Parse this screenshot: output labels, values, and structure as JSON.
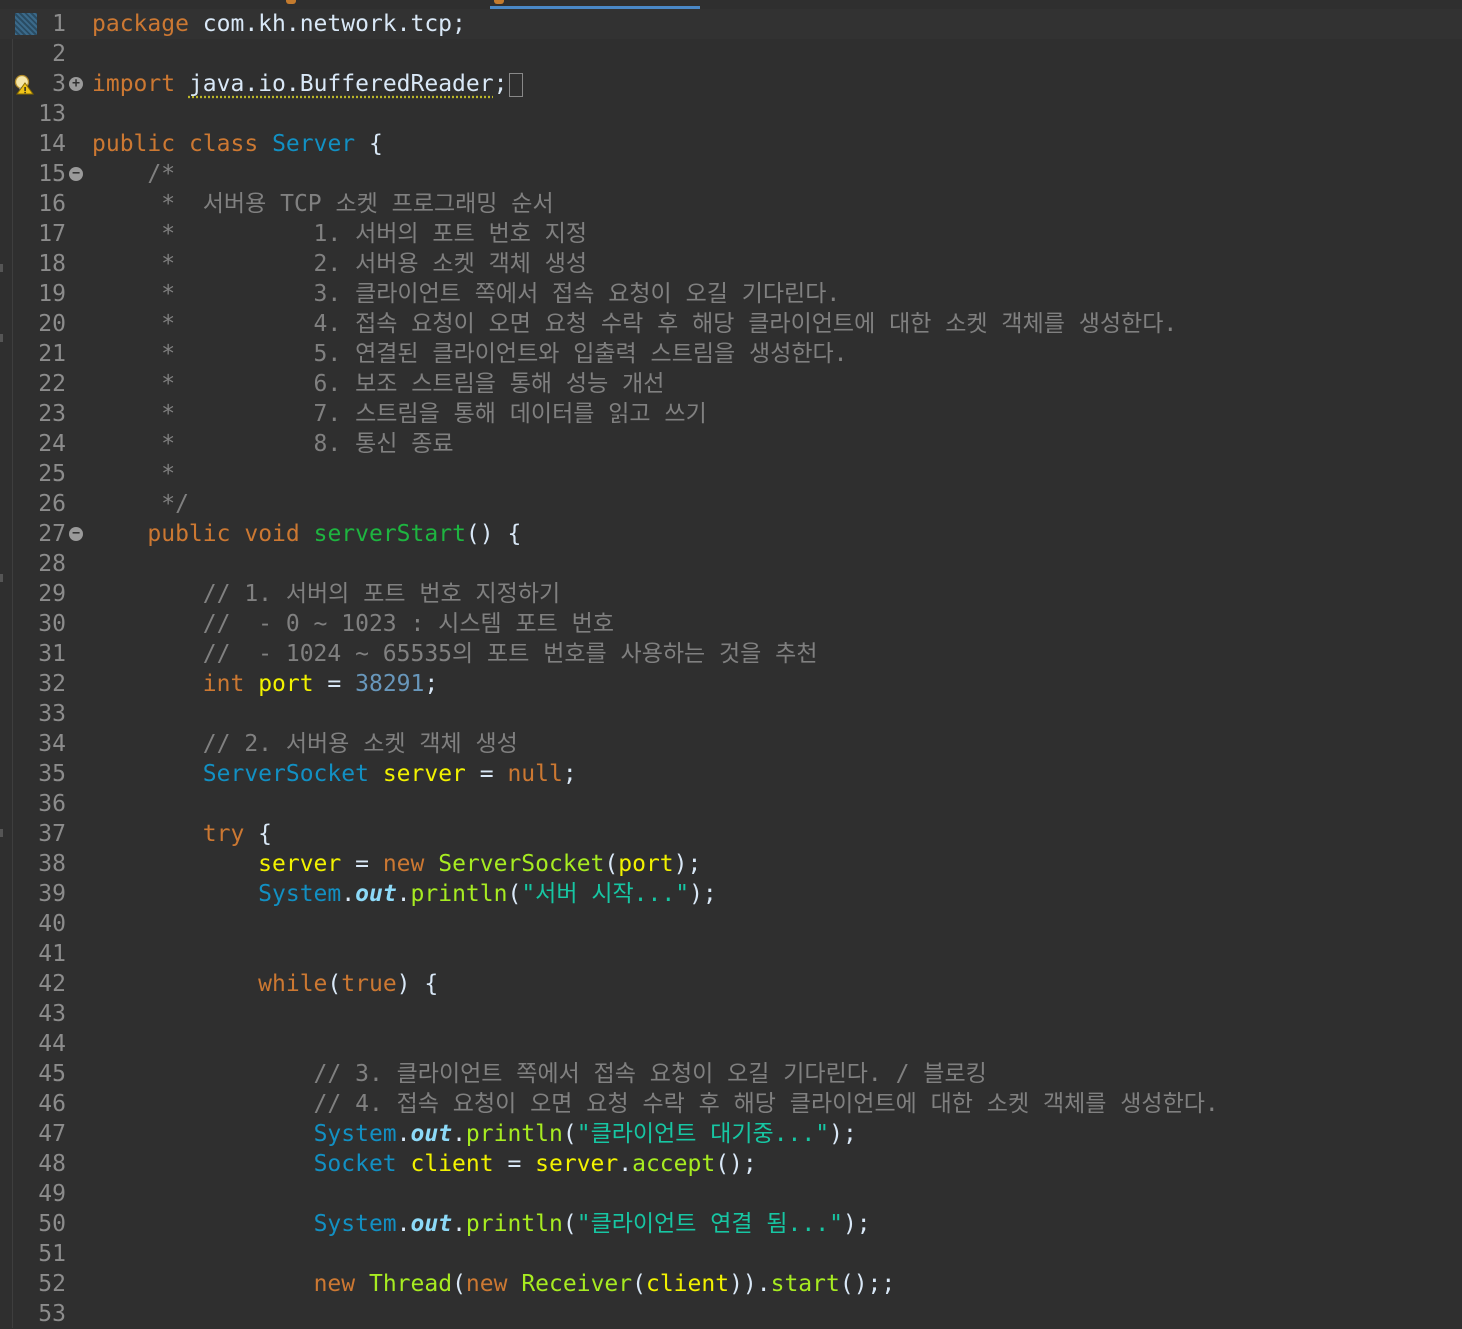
{
  "editor": {
    "lines": [
      {
        "n": "1",
        "tokens": [
          [
            "kw",
            "package"
          ],
          [
            "p",
            " com.kh.network.tcp;"
          ]
        ],
        "current": true
      },
      {
        "n": "2",
        "tokens": []
      },
      {
        "n": "3",
        "tokens": [
          [
            "kw",
            "import"
          ],
          [
            "p",
            " "
          ],
          [
            "warn",
            "java.io.BufferedReader"
          ],
          [
            "p",
            ";"
          ]
        ],
        "collapsed": true,
        "fold": "+"
      },
      {
        "n": "13",
        "tokens": []
      },
      {
        "n": "14",
        "tokens": [
          [
            "kw",
            "public"
          ],
          [
            "p",
            " "
          ],
          [
            "kw",
            "class"
          ],
          [
            "p",
            " "
          ],
          [
            "cls",
            "Server"
          ],
          [
            "p",
            " {"
          ]
        ]
      },
      {
        "n": "15",
        "tokens": [
          [
            "cmt",
            "    /*"
          ]
        ],
        "fold": "−"
      },
      {
        "n": "16",
        "tokens": [
          [
            "cmt",
            "     *  서버용 TCP 소켓 프로그래밍 순서"
          ]
        ]
      },
      {
        "n": "17",
        "tokens": [
          [
            "cmt",
            "     *          1. 서버의 포트 번호 지정"
          ]
        ]
      },
      {
        "n": "18",
        "tokens": [
          [
            "cmt",
            "     *          2. 서버용 소켓 객체 생성"
          ]
        ]
      },
      {
        "n": "19",
        "tokens": [
          [
            "cmt",
            "     *          3. 클라이언트 쪽에서 접속 요청이 오길 기다린다."
          ]
        ]
      },
      {
        "n": "20",
        "tokens": [
          [
            "cmt",
            "     *          4. 접속 요청이 오면 요청 수락 후 해당 클라이언트에 대한 소켓 객체를 생성한다."
          ]
        ]
      },
      {
        "n": "21",
        "tokens": [
          [
            "cmt",
            "     *          5. 연결된 클라이언트와 입출력 스트림을 생성한다."
          ]
        ]
      },
      {
        "n": "22",
        "tokens": [
          [
            "cmt",
            "     *          6. 보조 스트림을 통해 성능 개선"
          ]
        ]
      },
      {
        "n": "23",
        "tokens": [
          [
            "cmt",
            "     *          7. 스트림을 통해 데이터를 읽고 쓰기"
          ]
        ]
      },
      {
        "n": "24",
        "tokens": [
          [
            "cmt",
            "     *          8. 통신 종료"
          ]
        ]
      },
      {
        "n": "25",
        "tokens": [
          [
            "cmt",
            "     *"
          ]
        ]
      },
      {
        "n": "26",
        "tokens": [
          [
            "cmt",
            "     */"
          ]
        ]
      },
      {
        "n": "27",
        "tokens": [
          [
            "p",
            "    "
          ],
          [
            "kw",
            "public"
          ],
          [
            "p",
            " "
          ],
          [
            "kw",
            "void"
          ],
          [
            "p",
            " "
          ],
          [
            "type",
            "serverStart"
          ],
          [
            "p",
            "() {"
          ]
        ],
        "fold": "−"
      },
      {
        "n": "28",
        "tokens": []
      },
      {
        "n": "29",
        "tokens": [
          [
            "cmt",
            "        // 1. 서버의 포트 번호 지정하기"
          ]
        ]
      },
      {
        "n": "30",
        "tokens": [
          [
            "cmt",
            "        //  - 0 ~ 1023 : 시스템 포트 번호"
          ]
        ]
      },
      {
        "n": "31",
        "tokens": [
          [
            "cmt",
            "        //  - 1024 ~ 65535의 포트 번호를 사용하는 것을 추천"
          ]
        ]
      },
      {
        "n": "32",
        "tokens": [
          [
            "p",
            "        "
          ],
          [
            "kw",
            "int"
          ],
          [
            "p",
            " "
          ],
          [
            "var",
            "port"
          ],
          [
            "p",
            " = "
          ],
          [
            "num",
            "38291"
          ],
          [
            "p",
            ";"
          ]
        ]
      },
      {
        "n": "33",
        "tokens": []
      },
      {
        "n": "34",
        "tokens": [
          [
            "cmt",
            "        // 2. 서버용 소켓 객체 생성"
          ]
        ]
      },
      {
        "n": "35",
        "tokens": [
          [
            "p",
            "        "
          ],
          [
            "cls",
            "ServerSocket"
          ],
          [
            "p",
            " "
          ],
          [
            "var",
            "server"
          ],
          [
            "p",
            " = "
          ],
          [
            "kw",
            "null"
          ],
          [
            "p",
            ";"
          ]
        ]
      },
      {
        "n": "36",
        "tokens": []
      },
      {
        "n": "37",
        "tokens": [
          [
            "p",
            "        "
          ],
          [
            "kw",
            "try"
          ],
          [
            "p",
            " {"
          ]
        ]
      },
      {
        "n": "38",
        "tokens": [
          [
            "p",
            "            "
          ],
          [
            "var",
            "server"
          ],
          [
            "p",
            " = "
          ],
          [
            "kw",
            "new"
          ],
          [
            "p",
            " "
          ],
          [
            "method",
            "ServerSocket"
          ],
          [
            "p",
            "("
          ],
          [
            "var",
            "port"
          ],
          [
            "p",
            ");"
          ]
        ]
      },
      {
        "n": "39",
        "tokens": [
          [
            "p",
            "            "
          ],
          [
            "cls",
            "System"
          ],
          [
            "p",
            "."
          ],
          [
            "fld",
            "out"
          ],
          [
            "p",
            "."
          ],
          [
            "method",
            "println"
          ],
          [
            "p",
            "("
          ],
          [
            "str",
            "\"서버 시작...\""
          ],
          [
            "p",
            ");"
          ]
        ]
      },
      {
        "n": "40",
        "tokens": []
      },
      {
        "n": "41",
        "tokens": []
      },
      {
        "n": "42",
        "tokens": [
          [
            "p",
            "            "
          ],
          [
            "kw",
            "while"
          ],
          [
            "p",
            "("
          ],
          [
            "kw",
            "true"
          ],
          [
            "p",
            ") {"
          ]
        ]
      },
      {
        "n": "43",
        "tokens": []
      },
      {
        "n": "44",
        "tokens": []
      },
      {
        "n": "45",
        "tokens": [
          [
            "cmt",
            "                // 3. 클라이언트 쪽에서 접속 요청이 오길 기다린다. / 블로킹"
          ]
        ]
      },
      {
        "n": "46",
        "tokens": [
          [
            "cmt",
            "                // 4. 접속 요청이 오면 요청 수락 후 해당 클라이언트에 대한 소켓 객체를 생성한다."
          ]
        ]
      },
      {
        "n": "47",
        "tokens": [
          [
            "p",
            "                "
          ],
          [
            "cls",
            "System"
          ],
          [
            "p",
            "."
          ],
          [
            "fld",
            "out"
          ],
          [
            "p",
            "."
          ],
          [
            "method",
            "println"
          ],
          [
            "p",
            "("
          ],
          [
            "str",
            "\"클라이언트 대기중...\""
          ],
          [
            "p",
            ");"
          ]
        ]
      },
      {
        "n": "48",
        "tokens": [
          [
            "p",
            "                "
          ],
          [
            "cls",
            "Socket"
          ],
          [
            "p",
            " "
          ],
          [
            "var",
            "client"
          ],
          [
            "p",
            " = "
          ],
          [
            "var",
            "server"
          ],
          [
            "p",
            "."
          ],
          [
            "method",
            "accept"
          ],
          [
            "p",
            "();"
          ]
        ]
      },
      {
        "n": "49",
        "tokens": []
      },
      {
        "n": "50",
        "tokens": [
          [
            "p",
            "                "
          ],
          [
            "cls",
            "System"
          ],
          [
            "p",
            "."
          ],
          [
            "fld",
            "out"
          ],
          [
            "p",
            "."
          ],
          [
            "method",
            "println"
          ],
          [
            "p",
            "("
          ],
          [
            "str",
            "\"클라이언트 연결 됨...\""
          ],
          [
            "p",
            ");"
          ]
        ]
      },
      {
        "n": "51",
        "tokens": []
      },
      {
        "n": "52",
        "tokens": [
          [
            "p",
            "                "
          ],
          [
            "kw",
            "new"
          ],
          [
            "p",
            " "
          ],
          [
            "method",
            "Thread"
          ],
          [
            "p",
            "("
          ],
          [
            "kw",
            "new"
          ],
          [
            "p",
            " "
          ],
          [
            "method",
            "Receiver"
          ],
          [
            "p",
            "("
          ],
          [
            "var",
            "client"
          ],
          [
            "p",
            "))."
          ],
          [
            "method",
            "start"
          ],
          [
            "p",
            "();;"
          ]
        ]
      },
      {
        "n": "53",
        "tokens": []
      }
    ]
  },
  "colors": {
    "background": "#2f2f2f",
    "keyword": "#cc7832",
    "class": "#1290c3",
    "method": "#a7ec21",
    "variable": "#f2f200",
    "number": "#6897bb",
    "comment": "#808080",
    "string": "#17c6a3"
  },
  "icons": {
    "line1": "selection-marker-icon",
    "line3": "warning-lightbulb-icon"
  }
}
